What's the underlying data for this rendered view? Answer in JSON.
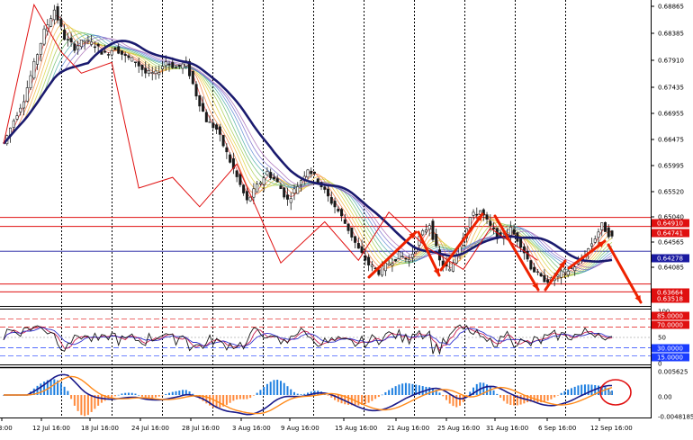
{
  "price_axis": {
    "ticks": [
      "0.68865",
      "0.68385",
      "0.67910",
      "0.67435",
      "0.66955",
      "0.66475",
      "0.65995",
      "0.65520",
      "0.65040",
      "0.64565",
      "0.64085"
    ],
    "tags": [
      {
        "label": "0.64910",
        "color": "#e01010"
      },
      {
        "label": "0.64741",
        "color": "#e01010"
      },
      {
        "label": "0.64278",
        "color": "#1a1aa0"
      },
      {
        "label": "0.63664",
        "color": "#e01010"
      },
      {
        "label": "0.63518",
        "color": "#e01010"
      }
    ]
  },
  "rsi_axis": {
    "ticks": [
      "100",
      "50",
      "0"
    ],
    "tags": [
      {
        "label": "85.0000",
        "color": "#e01010"
      },
      {
        "label": "70.0000",
        "color": "#e01010"
      },
      {
        "label": "30.0000",
        "color": "#1a3cff"
      },
      {
        "label": "15.0000",
        "color": "#1a3cff"
      }
    ]
  },
  "macd_axis": {
    "ticks": [
      "0.005625",
      "0.00",
      "-0.0048185"
    ]
  },
  "time_axis": [
    "3:00",
    "12 Jul 16:00",
    "18 Jul 16:00",
    "24 Jul 16:00",
    "28 Jul 16:00",
    "3 Aug 16:00",
    "9 Aug 16:00",
    "15 Aug 16:00",
    "21 Aug 16:00",
    "25 Aug 16:00",
    "31 Aug 16:00",
    "6 Sep 16:00",
    "12 Sep 16:00"
  ],
  "colors": {
    "candle": "#1a1a1a",
    "ma_main": "#1a1a6e",
    "zigzag": "#e01010",
    "arrow": "#ee2200",
    "level_line": "#e01010",
    "current_line": "#1a1aa0",
    "rsi_fast": "#1a1a1a",
    "rsi_slow": "#cc2255",
    "rsi_signal": "#3333cc",
    "hist_up": "#1e7fe0",
    "hist_down": "#ff8a3c",
    "macd_line": "#1a1a8a",
    "signal_line": "#ff8a1a"
  },
  "chart_data": {
    "type": "line",
    "title": "",
    "price_close": [
      0.6628,
      0.6672,
      0.6712,
      0.6776,
      0.6838,
      0.6879,
      0.6826,
      0.6808,
      0.6821,
      0.6812,
      0.6795,
      0.6808,
      0.679,
      0.6782,
      0.676,
      0.6758,
      0.6782,
      0.677,
      0.6778,
      0.672,
      0.6672,
      0.6655,
      0.661,
      0.6565,
      0.652,
      0.6548,
      0.6575,
      0.6555,
      0.6522,
      0.655,
      0.6582,
      0.656,
      0.6528,
      0.6502,
      0.6468,
      0.643,
      0.6402,
      0.6388,
      0.6405,
      0.642,
      0.641,
      0.6452,
      0.6478,
      0.6408,
      0.639,
      0.644,
      0.649,
      0.6503,
      0.6472,
      0.6448,
      0.6468,
      0.644,
      0.6398,
      0.6376,
      0.6372,
      0.6385,
      0.6395,
      0.641,
      0.6442,
      0.6475,
      0.6452
    ],
    "horizontal_levels": [
      0.6491,
      0.64741,
      0.64278,
      0.63664,
      0.63518
    ],
    "rsi_levels": [
      85,
      70,
      30,
      15
    ],
    "price_ylim": [
      0.6328,
      0.689
    ],
    "rsi_ylim": [
      0,
      100
    ],
    "macd_ylim": [
      -0.0048185,
      0.005625
    ],
    "x_labels": [
      "3:00",
      "12 Jul 16:00",
      "18 Jul 16:00",
      "24 Jul 16:00",
      "28 Jul 16:00",
      "3 Aug 16:00",
      "9 Aug 16:00",
      "15 Aug 16:00",
      "21 Aug 16:00",
      "25 Aug 16:00",
      "31 Aug 16:00",
      "6 Sep 16:00",
      "12 Sep 16:00"
    ]
  }
}
